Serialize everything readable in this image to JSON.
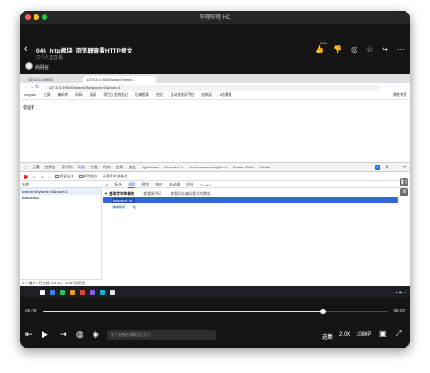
{
  "app": {
    "title": "哔哩哔哩 HD"
  },
  "video": {
    "title": "046_http模块_浏览器查看HTTP报文",
    "subtitle": "⊙ 5人正在看",
    "uploader": "尚硅谷",
    "like_count": "8411"
  },
  "browser": {
    "tabs": [
      "127.0.0.1:9000",
      "127.0.0.1:9000/search?keyw..."
    ],
    "url": "127.0.0.1:9000/search?keyword=h5&num=1",
    "bookmarks": [
      "program",
      "工具",
      "编码库",
      "码码",
      "阅读",
      "项目大全的笔记",
      "后端框架",
      "经验",
      "自动化测试平台",
      "创新园",
      "B站素材"
    ],
    "bookmark_right": "其他书签",
    "page_text": "你好"
  },
  "devtools": {
    "tabs": [
      "元素",
      "控制台",
      "源代码",
      "网络",
      "性能",
      "内存",
      "应用",
      "安全",
      "Lighthouse",
      "Recorder ⚠",
      "Performance insights ⚠",
      "Cookie Editor",
      "Redux"
    ],
    "selected_tab": "网络",
    "badge": "1",
    "toolbar": [
      "保留日志",
      "停用缓存",
      "已停用节流模式"
    ],
    "list_header": "名称",
    "requests": [
      "search?keyword=h5&num=1",
      "favicon.ico"
    ],
    "detail_tabs": [
      "标头",
      "载荷",
      "预览",
      "响应",
      "启动器",
      "时间",
      "Cookie"
    ],
    "selected_detail_tab": "载荷",
    "query_heading": "▼ 查询字符串参数",
    "query_actions": [
      "查看源代码",
      "查看网址编码格式的数据"
    ],
    "param1": "keyword: h5",
    "param2": "num: 1",
    "status": "2 个请求 | 已传输 334 B | 1.6 kB 项资源"
  },
  "player": {
    "current_time": "06:43",
    "total_time": "08:22",
    "progress": 0.81,
    "danmu_placeholder": "发个友善的弹幕见证当下",
    "select_label": "选集",
    "speed_label": "2.0X",
    "quality_label": "1080P"
  }
}
